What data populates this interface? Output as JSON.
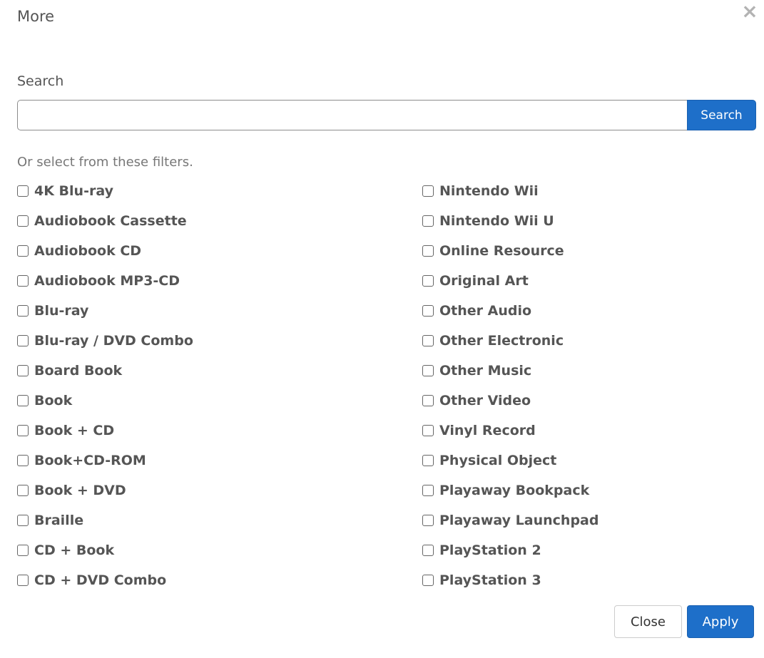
{
  "modal": {
    "title": "More",
    "close_glyph": "×"
  },
  "search": {
    "label": "Search",
    "value": "",
    "placeholder": "",
    "button_label": "Search"
  },
  "filters": {
    "hint": "Or select from these filters.",
    "left": [
      {
        "label": "4K Blu-ray",
        "checked": false
      },
      {
        "label": "Audiobook Cassette",
        "checked": false
      },
      {
        "label": "Audiobook CD",
        "checked": false
      },
      {
        "label": "Audiobook MP3-CD",
        "checked": false
      },
      {
        "label": "Blu-ray",
        "checked": false
      },
      {
        "label": "Blu-ray / DVD Combo",
        "checked": false
      },
      {
        "label": "Board Book",
        "checked": false
      },
      {
        "label": "Book",
        "checked": false
      },
      {
        "label": "Book + CD",
        "checked": false
      },
      {
        "label": "Book+CD-ROM",
        "checked": false
      },
      {
        "label": "Book + DVD",
        "checked": false
      },
      {
        "label": "Braille",
        "checked": false
      },
      {
        "label": "CD + Book",
        "checked": false
      },
      {
        "label": "CD + DVD Combo",
        "checked": false
      }
    ],
    "right": [
      {
        "label": "Nintendo Wii",
        "checked": false
      },
      {
        "label": "Nintendo Wii U",
        "checked": false
      },
      {
        "label": "Online Resource",
        "checked": false
      },
      {
        "label": "Original Art",
        "checked": false
      },
      {
        "label": "Other Audio",
        "checked": false
      },
      {
        "label": "Other Electronic",
        "checked": false
      },
      {
        "label": "Other Music",
        "checked": false
      },
      {
        "label": "Other Video",
        "checked": false
      },
      {
        "label": "Vinyl Record",
        "checked": false
      },
      {
        "label": "Physical Object",
        "checked": false
      },
      {
        "label": "Playaway Bookpack",
        "checked": false
      },
      {
        "label": "Playaway Launchpad",
        "checked": false
      },
      {
        "label": "PlayStation 2",
        "checked": false
      },
      {
        "label": "PlayStation 3",
        "checked": false
      }
    ]
  },
  "footer": {
    "close_label": "Close",
    "apply_label": "Apply"
  },
  "colors": {
    "primary": "#1e6fc9",
    "text": "#555555",
    "muted": "#777777",
    "close_icon": "#b3b3b3"
  },
  "icons": {
    "close": "close-icon",
    "checkbox": "checkbox-icon"
  }
}
